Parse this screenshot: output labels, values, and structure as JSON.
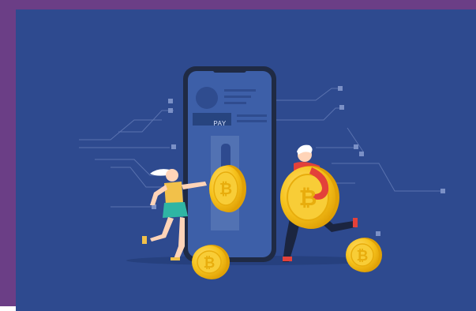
{
  "illustration": {
    "subject": "crypto-payment",
    "pay_button_label": "PAY",
    "coin_symbol": "₿"
  },
  "colors": {
    "frame": "#6b3e86",
    "background": "#2e4a8f",
    "phone_body": "#1f2a44",
    "phone_screen": "#3d5fa8",
    "coin_gold": "#f6c21c",
    "coin_dark": "#e0a106",
    "circuit_lines": "#5f77b3"
  }
}
